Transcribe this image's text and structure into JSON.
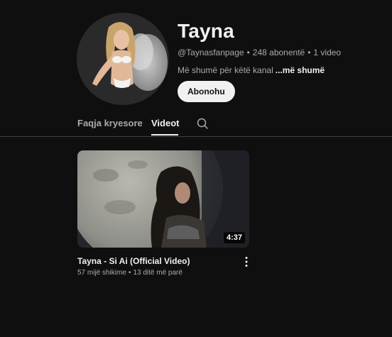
{
  "channel": {
    "name": "Tayna",
    "handle": "@Taynasfanpage",
    "subscribers": "248 abonentë",
    "video_count": "1 video",
    "separator": "•",
    "description": "Më shumë për këtë kanal",
    "more_link": "...më shumë",
    "subscribe_label": "Abonohu"
  },
  "tabs": [
    {
      "label": "Faqja kryesore",
      "active": false
    },
    {
      "label": "Videot",
      "active": true
    }
  ],
  "video": {
    "title": "Tayna - Si Ai (Official Video)",
    "views": "57 mijë shikime",
    "age": "13 ditë më parë",
    "separator": "•",
    "duration": "4:37"
  },
  "colors": {
    "background": "#0f0f0f",
    "primary_text": "#f1f1f1",
    "secondary_text": "#aaaaaa",
    "subscribe_bg": "#f1f1f1",
    "divider": "#3f3f3f"
  }
}
